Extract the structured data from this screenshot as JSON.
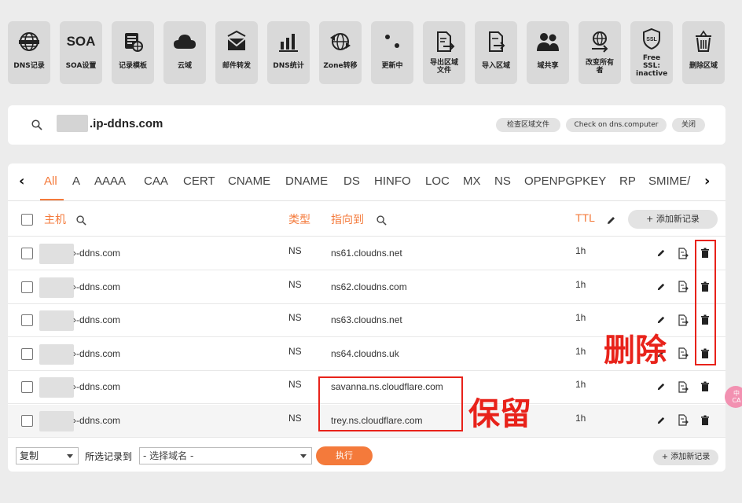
{
  "toolbar": {
    "items": [
      {
        "label": "DNS记录",
        "icon": "globe-icon"
      },
      {
        "label": "SOA设置",
        "icon": "soa-text-icon",
        "glyph": "SOA"
      },
      {
        "label": "记录模板",
        "icon": "template-icon"
      },
      {
        "label": "云域",
        "icon": "cloud-icon"
      },
      {
        "label": "邮件转发",
        "icon": "mail-forward-icon"
      },
      {
        "label": "DNS统计",
        "icon": "bar-chart-icon"
      },
      {
        "label": "Zone转移",
        "icon": "zone-transfer-icon"
      },
      {
        "label": "更新中",
        "icon": "dots-icon"
      },
      {
        "label": "导出区域文件",
        "icon": "export-file-icon"
      },
      {
        "label": "导入区域",
        "icon": "import-file-icon"
      },
      {
        "label": "域共享",
        "icon": "users-icon"
      },
      {
        "label": "改变所有者",
        "icon": "change-owner-icon"
      },
      {
        "label": "Free SSL: inactive",
        "icon": "ssl-shield-icon",
        "glyph": "SSL"
      },
      {
        "label": "删除区域",
        "icon": "trash-icon"
      }
    ]
  },
  "search": {
    "domain_suffix": ".ip-ddns.com",
    "check_zone_label": "检查区域文件",
    "check_dns_label": "Check on dns.computer",
    "close_label": "关闭"
  },
  "tabs": [
    "All",
    "A",
    "AAAA",
    "CAA",
    "CERT",
    "CNAME",
    "DNAME",
    "DS",
    "HINFO",
    "LOC",
    "MX",
    "NS",
    "OPENPGPKEY",
    "RP",
    "SMIME/"
  ],
  "active_tab": "All",
  "table": {
    "headers": {
      "host": "主机",
      "type": "类型",
      "points_to": "指向到",
      "ttl": "TTL"
    },
    "add_record_label": "+ 添加新记录",
    "rows": [
      {
        "host": "›-ddns.com",
        "type": "NS",
        "points_to": "ns61.cloudns.net",
        "ttl": "1h"
      },
      {
        "host": "›-ddns.com",
        "type": "NS",
        "points_to": "ns62.cloudns.com",
        "ttl": "1h"
      },
      {
        "host": "›-ddns.com",
        "type": "NS",
        "points_to": "ns63.cloudns.net",
        "ttl": "1h"
      },
      {
        "host": "›-ddns.com",
        "type": "NS",
        "points_to": "ns64.cloudns.uk",
        "ttl": "1h"
      },
      {
        "host": "›-ddns.com",
        "type": "NS",
        "points_to": "savanna.ns.cloudflare.com",
        "ttl": "1h"
      },
      {
        "host": "›-ddns.com",
        "type": "NS",
        "points_to": "trey.ns.cloudflare.com",
        "ttl": "1h"
      }
    ]
  },
  "footer": {
    "action_select": "复制",
    "selected_to_label": "所选记录到",
    "domain_select_placeholder": "- 选择域名 -",
    "run_label": "执行",
    "add_record_label": "+ 添加新记录"
  },
  "annotations": {
    "delete_label": "删除",
    "keep_label": "保留",
    "color": "#e8221a"
  },
  "side_bubble": {
    "line1": "中",
    "line2": "CA"
  },
  "colors": {
    "accent": "#f47a3b",
    "annotation": "#e8221a"
  }
}
